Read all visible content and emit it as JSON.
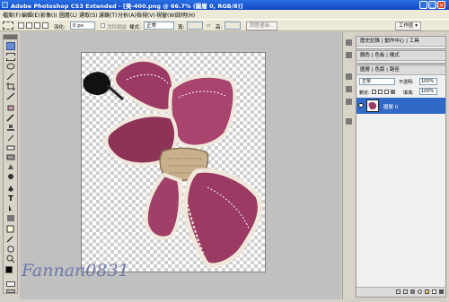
{
  "window": {
    "title": "Adobe Photoshop CS3 Extended - [美-400.png @ 66.7% (圖層 0, RGB/8)]"
  },
  "menu": [
    "檔案(F)",
    "編輯(E)",
    "影像(I)",
    "圖層(L)",
    "選取(S)",
    "濾鏡(T)",
    "分析(A)",
    "檢視(V)",
    "視窗(W)",
    "說明(H)"
  ],
  "options": {
    "feather_label": "羽化:",
    "feather_value": "0 px",
    "antialias_label": "消除鋸齒",
    "style_label": "樣式:",
    "style_value": "正常",
    "width_label": "寬:",
    "height_label": "高:",
    "refine_button": "調整邊緣...",
    "workspace_label": "工作區"
  },
  "panels": {
    "history_tabs": "歷史記錄 | 動作中心 | 工具",
    "color_tabs": "顏色 | 色板 | 樣式",
    "layers_tabs": "圖層 | 色版 | 路徑",
    "blend_mode": "正常",
    "opacity_label": "不透明:",
    "opacity_value": "100%",
    "lock_label": "鎖定:",
    "fill_label": "填滿:",
    "fill_value": "100%",
    "layer_name": "圖層 0"
  },
  "watermark": "Fannan0831",
  "colors": {
    "titlebar": "#1c5ad4",
    "ribbon": "#9b3a62",
    "selected_layer": "#3169c6"
  }
}
